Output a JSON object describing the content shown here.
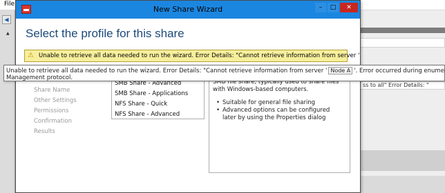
{
  "background": {
    "menu_file": "File",
    "right_snippet": "ss to all\" Error Details: \""
  },
  "wizard": {
    "title": "New Share Wizard",
    "heading": "Select the profile for this share",
    "window_buttons": {
      "minimize": "–",
      "maximize": "□",
      "close": "✕"
    }
  },
  "warning": {
    "icon": "warning-icon",
    "text_start": "Unable to retrieve all data needed to run the wizard. Error Details: \"Cannot retrieve information from server '",
    "text_end": "'..."
  },
  "tooltip": {
    "line1_start": "Unable to retrieve all data needed to run the wizard. Error Details: \"Cannot retrieve information from server '",
    "node_label": "Node A",
    "line1_end": "'. Error occurred during enumeration of quotas: The WinRM client",
    "line2": "Management protocol."
  },
  "steps": [
    {
      "label": "Share Name"
    },
    {
      "label": "Other Settings"
    },
    {
      "label": "Permissions"
    },
    {
      "label": "Confirmation"
    },
    {
      "label": "Results"
    }
  ],
  "profiles": [
    {
      "label": "SMB Share - Advanced"
    },
    {
      "label": "SMB Share - Applications"
    },
    {
      "label": "NFS Share - Quick"
    },
    {
      "label": "NFS Share - Advanced"
    }
  ],
  "description": {
    "text": "SMB file share, typically used to share files with Windows-based computers.",
    "bullets": [
      "Suitable for general file sharing",
      "Advanced options can be configured later by using the Properties dialog"
    ]
  },
  "colors": {
    "titlebar": "#1b86e0",
    "heading": "#1c4a7a",
    "warning_bg": "#f7ef9c",
    "close_button": "#c7271f"
  }
}
